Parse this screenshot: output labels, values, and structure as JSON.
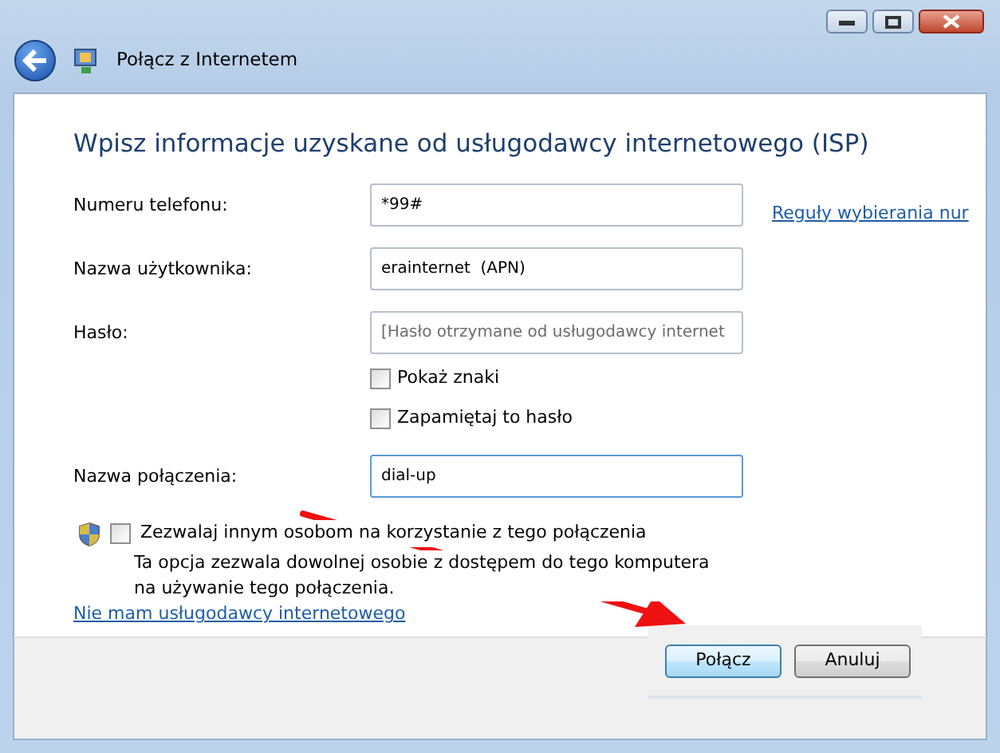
{
  "window": {
    "title": "Połącz z Internetem"
  },
  "heading": "Wpisz informacje uzyskane od usługodawcy internetowego (ISP)",
  "fields": [
    {
      "label": "Numeru telefonu:",
      "value": "*99#",
      "focused": false
    },
    {
      "label": "Nazwa użytkownika:",
      "value": "erainternet  (APN)",
      "focused": false
    },
    {
      "label": "Hasło:",
      "placeholder": "[Hasło otrzymane od usługodawcy internet",
      "focused": false
    },
    {
      "label": "Nazwa połączenia:",
      "value": "dial-up",
      "focused": true
    }
  ],
  "dialing_rules_link": "Reguły wybierania nur",
  "password_options": [
    {
      "label": "Pokaż znaki",
      "checked": false
    },
    {
      "label": "Zapamiętaj to hasło",
      "checked": false
    }
  ],
  "sharing": {
    "label": "Zezwalaj innym osobom na korzystanie z tego połączenia",
    "checked": false,
    "description": "Ta opcja zezwala dowolnej osobie z dostępem do tego komputera na używanie tego połączenia."
  },
  "no_isp_link": "Nie mam usługodawcy internetowego",
  "buttons": [
    {
      "label": "Połącz",
      "default": true
    },
    {
      "label": "Anuluj",
      "default": false
    }
  ]
}
